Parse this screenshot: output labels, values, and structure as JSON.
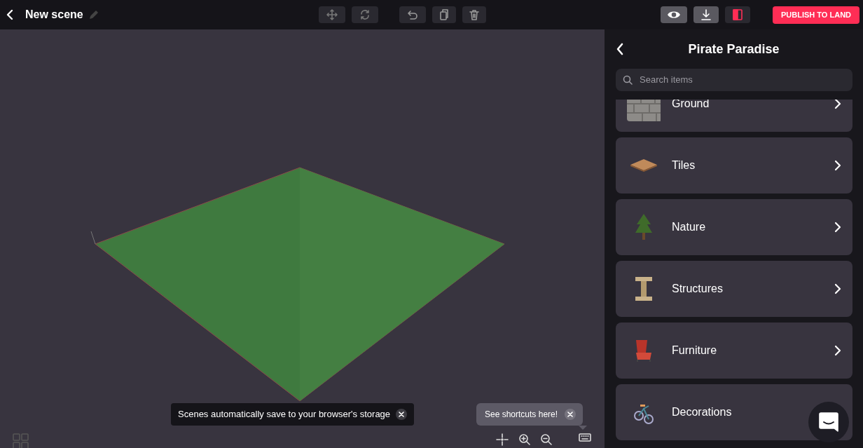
{
  "topbar": {
    "title": "New scene",
    "publish_button": "PUBLISH TO LAND"
  },
  "panel": {
    "title": "Pirate Paradise",
    "search": {
      "placeholder": "Search items"
    },
    "categories": [
      {
        "label": "Ground",
        "kind": "ground"
      },
      {
        "label": "Tiles",
        "kind": "tiles"
      },
      {
        "label": "Nature",
        "kind": "nature"
      },
      {
        "label": "Structures",
        "kind": "structures"
      },
      {
        "label": "Furniture",
        "kind": "furniture"
      },
      {
        "label": "Decorations",
        "kind": "decorations"
      }
    ]
  },
  "viewport": {
    "toast": "Scenes automatically save to your browser's storage",
    "shortcuts_tooltip": "See shortcuts here!"
  }
}
